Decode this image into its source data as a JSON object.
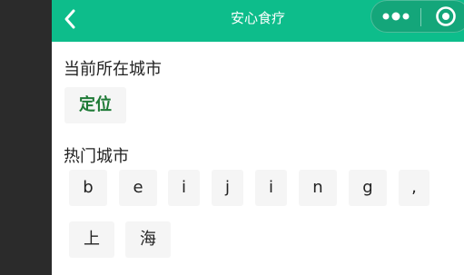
{
  "colors": {
    "navbar": "#0dbd8b",
    "locate_text": "#1e7a36",
    "chip_bg": "#f5f5f5"
  },
  "navbar": {
    "back_icon": "chevron-left-icon",
    "title": "安心食疗",
    "more_icon": "more-dots-icon",
    "close_icon": "mini-program-close-icon"
  },
  "current_city": {
    "heading": "当前所在城市",
    "locate_label": "定位"
  },
  "hot_cities": {
    "heading": "热门城市",
    "items": [
      "b",
      "e",
      "i",
      "j",
      "i",
      "n",
      "g",
      ",",
      "上",
      "海"
    ]
  }
}
